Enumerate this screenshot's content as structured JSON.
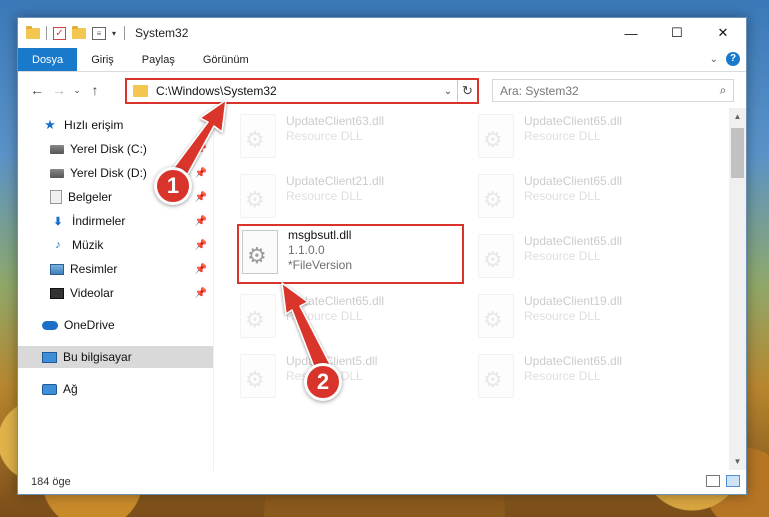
{
  "window": {
    "title": "System32"
  },
  "titlebar": {
    "minimize": "—",
    "maximize": "☐",
    "close": "✕"
  },
  "ribbon": {
    "tabs": [
      {
        "label": "Dosya",
        "active": true
      },
      {
        "label": "Giriş"
      },
      {
        "label": "Paylaş"
      },
      {
        "label": "Görünüm"
      }
    ]
  },
  "nav": {
    "back": "←",
    "forward": "→",
    "recent": "⌄",
    "up": "↑",
    "address": "C:\\Windows\\System32",
    "search_placeholder": "Ara: System32"
  },
  "sidebar": {
    "items": [
      {
        "label": "Hızlı erişim",
        "icon": "star-icon"
      },
      {
        "label": "Yerel Disk (C:)",
        "icon": "drive-icon",
        "pinned": true
      },
      {
        "label": "Yerel Disk (D:)",
        "icon": "drive-icon",
        "pinned": true
      },
      {
        "label": "Belgeler",
        "icon": "documents-icon",
        "pinned": true
      },
      {
        "label": "İndirmeler",
        "icon": "download-icon",
        "pinned": true
      },
      {
        "label": "Müzik",
        "icon": "music-icon",
        "pinned": true
      },
      {
        "label": "Resimler",
        "icon": "pictures-icon",
        "pinned": true
      },
      {
        "label": "Videolar",
        "icon": "videos-icon",
        "pinned": true
      },
      {
        "label": "OneDrive",
        "icon": "onedrive-icon"
      },
      {
        "label": "Bu bilgisayar",
        "icon": "this-pc-icon",
        "selected": true
      },
      {
        "label": "Ağ",
        "icon": "network-icon"
      }
    ]
  },
  "files": [
    {
      "name": "UpdateClient63.dll",
      "sub": "Resource DLL"
    },
    {
      "name": "UpdateClient65.dll",
      "sub": "Resource DLL"
    },
    {
      "name": "UpdateClient21.dll",
      "sub": "Resource DLL"
    },
    {
      "name": "UpdateClient65.dll",
      "sub": "Resource DLL"
    },
    {
      "name": "msgbsutl.dll",
      "sub": "1.1.0.0",
      "sub2": "*FileVersion"
    },
    {
      "name": "UpdateClient65.dll",
      "sub": "Resource DLL"
    },
    {
      "name": "UpdateClient65.dll",
      "sub": "Resource DLL"
    },
    {
      "name": "UpdateClient19.dll",
      "sub": "Resource DLL"
    },
    {
      "name": "UpdateClient5.dll",
      "sub": "Resource DLL"
    },
    {
      "name": "UpdateClient65.dll",
      "sub": "Resource DLL"
    }
  ],
  "status": {
    "count": "184 öge"
  },
  "annotations": {
    "badge1": "1",
    "badge2": "2",
    "color": "#d9342b"
  }
}
